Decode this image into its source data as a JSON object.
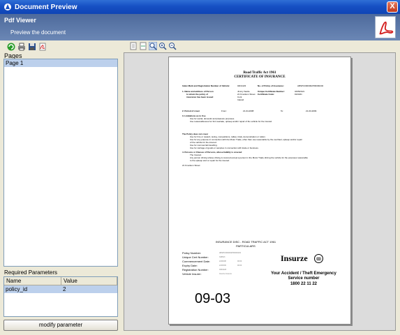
{
  "window": {
    "title": "Document Preview",
    "close_label": "X"
  },
  "header": {
    "title": "Pdf Viewer",
    "subtitle": "Preview the document"
  },
  "left_pane": {
    "pages_label": "Pages",
    "pages": [
      "Page 1"
    ],
    "params_label": "Required Parameters",
    "params_columns": [
      "Name",
      "Value"
    ],
    "params_rows": [
      {
        "name": "policy_id",
        "value": "2"
      }
    ],
    "modify_button": "modify parameter"
  },
  "document": {
    "heading1": "Road Traffic Act 1961",
    "heading2": "CERTIFICATE OF INSURANCE",
    "line_index": "Index Mark and Registration Number of Vehicle:",
    "line_index_val": "04D1423",
    "line_policy": "No. of Policy of Insurance:",
    "line_policy_val": "ABSPC0000002P00000232",
    "s1": "1.  Name and address of Person",
    "s1b": "to whom the policy of",
    "s1c": "insurance has been issued",
    "s1_name": "Jimmy Savile",
    "s1_addr1": "21 Knockum Street",
    "s1_addr2": "Cork",
    "s1_addr3": "Ireland",
    "s1_cert": "Unique Certificate Number:",
    "s1_cert_val": "343523/21",
    "s1_code": "Certificate Code:",
    "s1_code_val": "91/0221",
    "s2": "2.  Period of cover",
    "s2_from": "From:",
    "s2_from_val": "21-04-2008",
    "s2_to": "To:",
    "s2_to_val": "21-03-2009",
    "s3": "3.  Limitations as to Use",
    "s3a": "Use for social, domestic and pleasure purposes.",
    "s3b": "Use reasonableness for 3rd overtake, upkeep and/or repair of the vehicle for the insured.",
    "s_not": "The Policy does not cover",
    "s_not_a": "Use for hire or reward, racing, competitions, rallies, trials, demonstration or tuition.",
    "s_not_b": "Use for any purpose in connection with the Motor Trade, other than use reasonable by the overhaul, upkeep and/or repair",
    "s_not_c": "of the vehicle for the insured.",
    "s_not_d": "Use for commercial travelling.",
    "s_not_e": "Use for carriage of goods or samples in connection with trade or business.",
    "s4": "4.  Persons or Classes of Persons, whose liability is covered",
    "s4a": "The Insured.",
    "s4b": "Any person driving whose driving is covered except a person in the Motor Trade driving the vehicle for the purposes reasonable",
    "s4c": "to the upkeep and or repair for the insured.",
    "s5": "21 Knockum Street",
    "disc_title": "INSURANCE DISC - ROAD TRAFFIC ACT 1961",
    "disc_sub": "PARTICULARS",
    "disc_labels": [
      "Policy Number:",
      "Unique Cert Number:",
      "Commencement Date:",
      "Expiry Date:",
      "Registration Number:",
      "Vehicle Insurer:"
    ],
    "disc_values": [
      "ABSPC0000002P00000232",
      "343523",
      "21/04/08",
      "21/03/09",
      "04D1423",
      "Insurze Insurers"
    ],
    "disc_time1": "00:00",
    "disc_time2": "00:00",
    "brand": "Insurze",
    "contact1": "Your Accident / Theft Emergency",
    "contact2": "Service number",
    "contact3": "1800 22 11 22",
    "disc_code": "09-03"
  },
  "colors": {
    "selection": "#bcd0ec",
    "header": "#5a76a8",
    "titlebar": "#1650c4"
  }
}
